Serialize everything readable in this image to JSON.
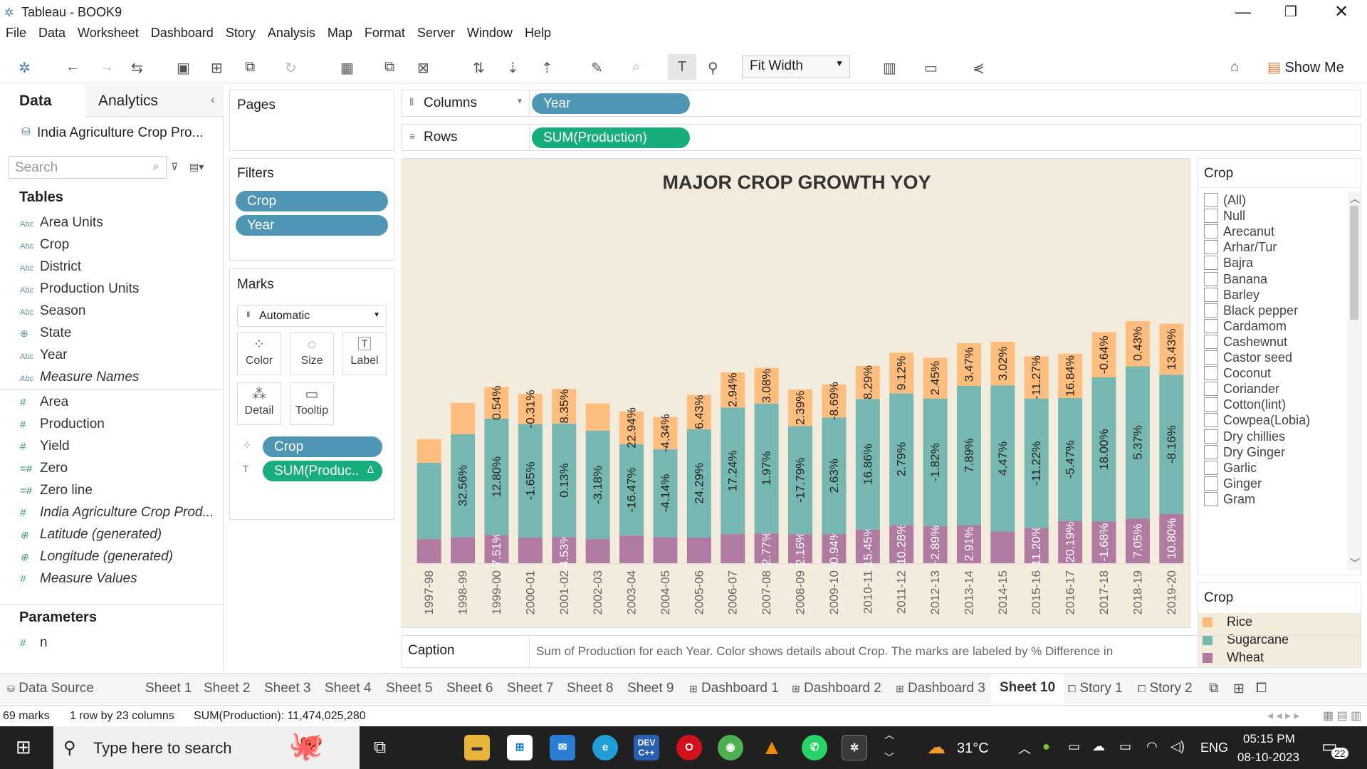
{
  "window": {
    "title": "Tableau - BOOK9"
  },
  "menu": [
    "File",
    "Data",
    "Worksheet",
    "Dashboard",
    "Story",
    "Analysis",
    "Map",
    "Format",
    "Server",
    "Window",
    "Help"
  ],
  "toolbar": {
    "fit": "Fit Width",
    "show_me": "Show Me"
  },
  "left_pane": {
    "tab_data": "Data",
    "tab_analytics": "Analytics",
    "datasource": "India Agriculture Crop Pro...",
    "search_placeholder": "Search",
    "tables_header": "Tables",
    "dimensions": [
      "Area Units",
      "Crop",
      "District",
      "Production Units",
      "Season",
      "State",
      "Year",
      "Measure Names"
    ],
    "measures": [
      "Area",
      "Production",
      "Yield",
      "Zero",
      "Zero line",
      "India Agriculture Crop Prod...",
      "Latitude (generated)",
      "Longitude (generated)",
      "Measure Values"
    ],
    "parameters_header": "Parameters",
    "parameters": [
      "n"
    ]
  },
  "pages": {
    "label": "Pages"
  },
  "filters": {
    "label": "Filters",
    "items": [
      "Crop",
      "Year"
    ]
  },
  "marks": {
    "label": "Marks",
    "type": "Automatic",
    "buttons": [
      "Color",
      "Size",
      "Label",
      "Detail",
      "Tooltip"
    ],
    "pills": [
      "Crop",
      "SUM(Produc.."
    ],
    "delta": "Δ"
  },
  "shelves": {
    "columns_label": "Columns",
    "columns_pill": "Year",
    "rows_label": "Rows",
    "rows_pill": "SUM(Production)"
  },
  "chart_data": {
    "type": "bar",
    "stacked": true,
    "title": "MAJOR CROP GROWTH YOY",
    "categories": [
      "1997-98",
      "1998-99",
      "1999-00",
      "2000-01",
      "2001-02",
      "2002-03",
      "2003-04",
      "2004-05",
      "2005-06",
      "2006-07",
      "2007-08",
      "2008-09",
      "2009-10",
      "2010-11",
      "2011-12",
      "2012-13",
      "2013-14",
      "2014-15",
      "2015-16",
      "2016-17",
      "2017-18",
      "2018-19",
      "2019-20"
    ],
    "series": [
      {
        "name": "Wheat",
        "color": "#b07aa1",
        "values": [
          48,
          52,
          56,
          51,
          52,
          48,
          55,
          52,
          51,
          58,
          60,
          58,
          58,
          67,
          76,
          74,
          76,
          63,
          70,
          84,
          83,
          89,
          98
        ],
        "labels": [
          "",
          "",
          "7.51%",
          "",
          "4.53%",
          "",
          "",
          "",
          "",
          "",
          "2.77%",
          "2.16%",
          "-0.94%",
          "15.45%",
          "10.28%",
          "-2.89%",
          "2.91%",
          "",
          "11.20%",
          "20.19%",
          "-1.68%",
          "7.05%",
          "10.80%"
        ]
      },
      {
        "name": "Sugarcane",
        "color": "#76b7b2",
        "values": [
          152,
          205,
          232,
          226,
          226,
          216,
          182,
          175,
          216,
          252,
          258,
          215,
          232,
          260,
          262,
          254,
          277,
          291,
          258,
          245,
          287,
          303,
          277
        ],
        "labels": [
          "",
          "32.56%",
          "12.80%",
          "-1.65%",
          "0.13%",
          "-3.18%",
          "-16.47%",
          "-4.14%",
          "24.29%",
          "17.24%",
          "1.97%",
          "-17.79%",
          "2.63%",
          "16.86%",
          "2.79%",
          "-1.82%",
          "7.89%",
          "4.47%",
          "-11.22%",
          "-5.47%",
          "18.00%",
          "5.37%",
          "-8.16%"
        ]
      },
      {
        "name": "Rice",
        "color": "#ffbe7d",
        "values": [
          47,
          62,
          63,
          60,
          69,
          54,
          65,
          64,
          68,
          70,
          71,
          73,
          66,
          66,
          81,
          81,
          85,
          87,
          84,
          88,
          90,
          90,
          102
        ],
        "labels": [
          "",
          "",
          "0.54%",
          "-0.31%",
          "8.35%",
          "",
          "22.94%",
          "-4.34%",
          "6.43%",
          "2.94%",
          "3.08%",
          "2.39%",
          "-8.69%",
          "8.29%",
          "9.12%",
          "2.45%",
          "3.47%",
          "3.02%",
          "-11.27%",
          "16.84%",
          "-0.64%",
          "0.43%",
          "13.43%"
        ]
      }
    ]
  },
  "crop_filter": {
    "label": "Crop",
    "items": [
      "(All)",
      "Null",
      "Arecanut",
      "Arhar/Tur",
      "Bajra",
      "Banana",
      "Barley",
      "Black pepper",
      "Cardamom",
      "Cashewnut",
      "Castor seed",
      "Coconut",
      "Coriander",
      "Cotton(lint)",
      "Cowpea(Lobia)",
      "Dry chillies",
      "Dry Ginger",
      "Garlic",
      "Ginger",
      "Gram"
    ]
  },
  "color_legend": {
    "label": "Crop",
    "items": [
      {
        "name": "Rice",
        "color": "#ffbe7d"
      },
      {
        "name": "Sugarcane",
        "color": "#76b7b2"
      },
      {
        "name": "Wheat",
        "color": "#b07aa1"
      }
    ]
  },
  "caption": {
    "label": "Caption",
    "text": "Sum of Production for each Year.  Color shows details about Crop.  The marks are labeled by % Difference in"
  },
  "sheet_tabs": [
    "Data Source",
    "Sheet 1",
    "Sheet 2",
    "Sheet 3",
    "Sheet 4",
    "Sheet 5",
    "Sheet 6",
    "Sheet 7",
    "Sheet 8",
    "Sheet 9",
    "Dashboard 1",
    "Dashboard 2",
    "Dashboard 3",
    "Sheet 10",
    "Story 1",
    "Story 2"
  ],
  "active_tab": "Sheet 10",
  "status": {
    "marks": "69 marks",
    "dims": "1 row by 23 columns",
    "sum": "SUM(Production): 11,474,025,280"
  },
  "taskbar": {
    "search_placeholder": "Type here to search",
    "weather": "31°C",
    "lang": "ENG",
    "time": "05:15 PM",
    "date": "08-10-2023",
    "notifications": "22"
  }
}
